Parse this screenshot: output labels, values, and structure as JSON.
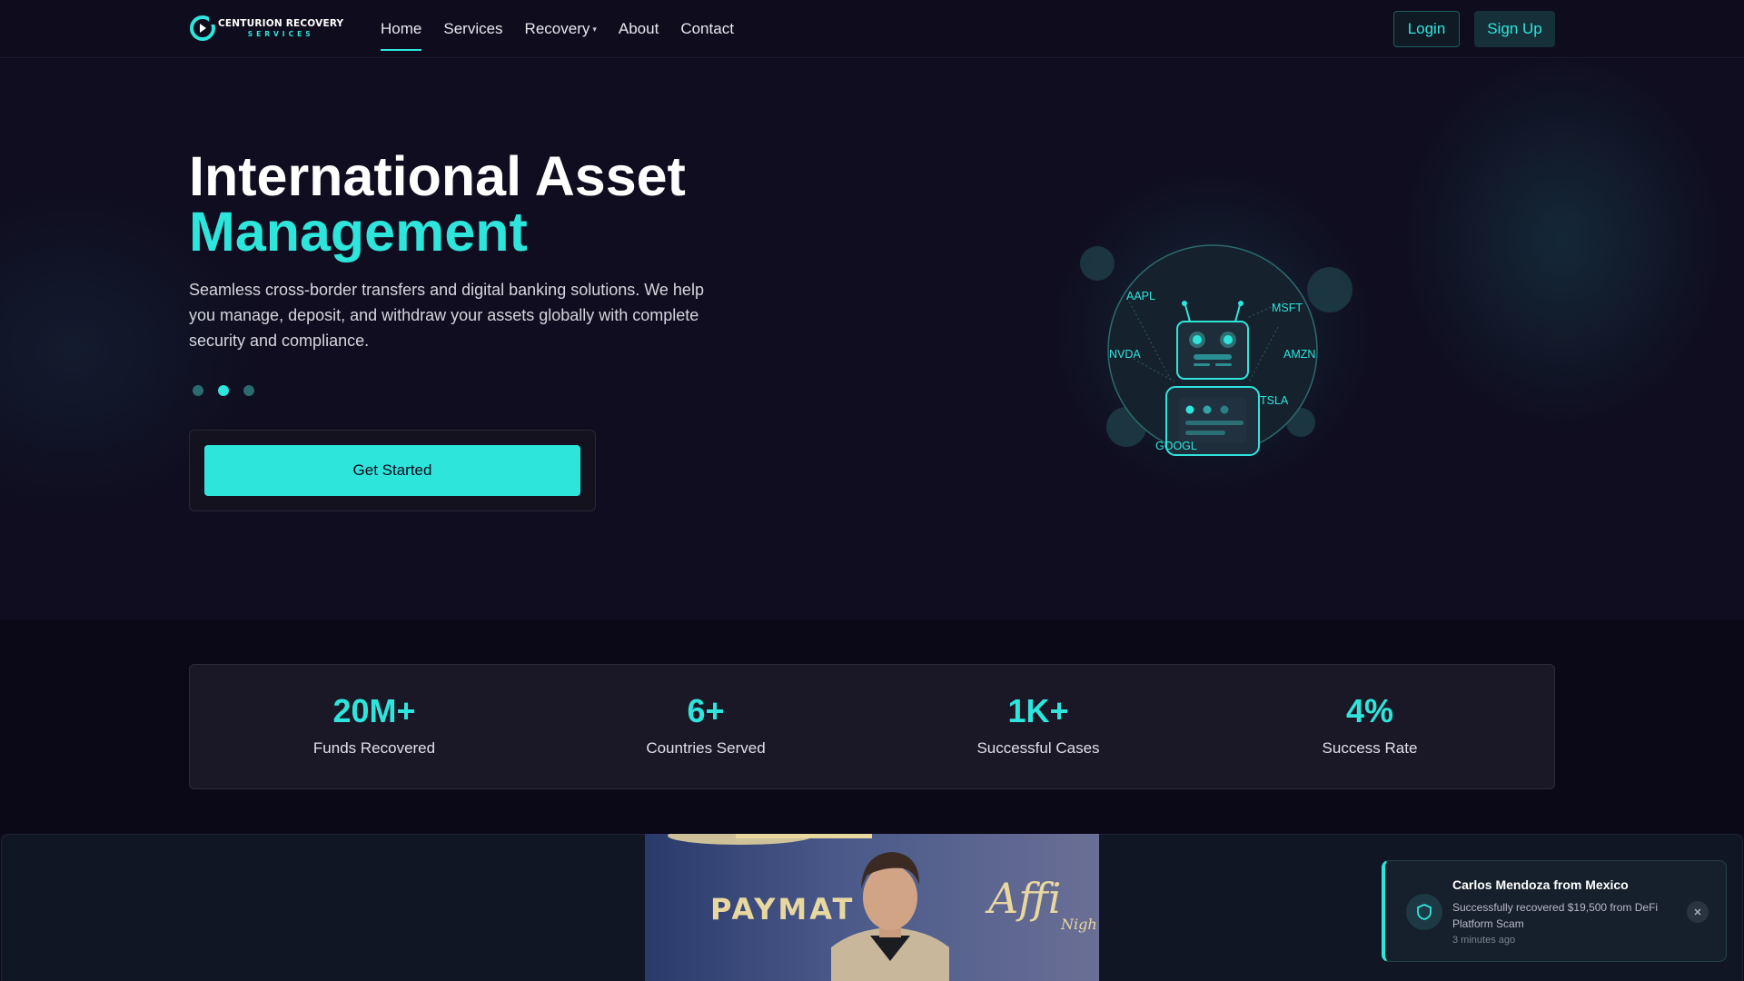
{
  "brand": {
    "name": "CENTURION RECOVERY",
    "tagline": "SERVICES",
    "accent": "#2ee5dc"
  },
  "nav": {
    "links": [
      {
        "label": "Home",
        "active": true
      },
      {
        "label": "Services"
      },
      {
        "label": "Recovery"
      },
      {
        "label": "About"
      },
      {
        "label": "Contact"
      }
    ],
    "recovery_caret": "▾",
    "login_label": "Login",
    "signup_label": "Sign Up"
  },
  "hero": {
    "title_line1": "International Asset",
    "title_line2": "Management",
    "description": "Seamless cross-border transfers and digital banking solutions. We help you manage, deposit, and withdraw your assets globally with complete security and compliance.",
    "slide_count": 3,
    "active_slide": 2,
    "cta_label": "Get Started",
    "tickers": [
      "AAPL",
      "MSFT",
      "NVDA",
      "AMZN",
      "GOOGL",
      "TSLA"
    ]
  },
  "stats": [
    {
      "value": "20M+",
      "label": "Funds Recovered"
    },
    {
      "value": "6+",
      "label": "Countries Served"
    },
    {
      "value": "1K+",
      "label": "Successful Cases"
    },
    {
      "value": "4%",
      "label": "Success Rate"
    }
  ],
  "photo": {
    "backdrop_text": "PAYMAT",
    "script_text": "Affi",
    "script_sub": "Nigh"
  },
  "toast": {
    "title": "Carlos Mendoza from Mexico",
    "body": "Successfully recovered $19,500 from DeFi Platform Scam",
    "time": "3 minutes ago",
    "icon": "shield-icon",
    "close_icon": "close-icon"
  }
}
